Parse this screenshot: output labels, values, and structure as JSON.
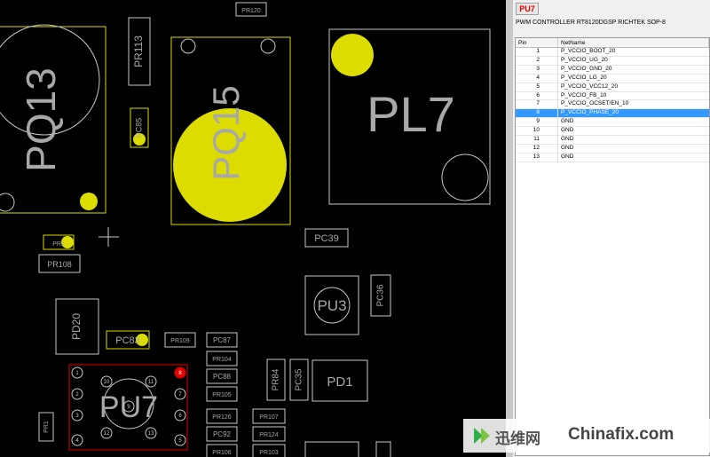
{
  "board": {
    "labels": {
      "pr120": "PR120",
      "pq13": "PQ13",
      "pr113": "PR113",
      "pc85": "PC85",
      "pq15": "PQ15",
      "pl7": "PL7",
      "pr1xx": "PR1",
      "pr108": "PR108",
      "pc39": "PC39",
      "pu3": "PU3",
      "pc36": "PC36",
      "pd20": "PD20",
      "pc83": "PC83",
      "pr109": "PR109",
      "pc87": "PC87",
      "pr104": "PR104",
      "pc88": "PC88",
      "pr105": "PR105",
      "pr84": "PR84",
      "pc35": "PC35",
      "pd1": "PD1",
      "pu7": "PU7",
      "pr126": "PR126",
      "pr107": "PR107",
      "pc92": "PC92",
      "pr124": "PR124",
      "pr106": "PR106",
      "pr103": "PR103",
      "pr1b": "PR1"
    },
    "pu7_pins": [
      "1",
      "2",
      "3",
      "4",
      "5",
      "6",
      "7",
      "8",
      "9",
      "10",
      "11",
      "12",
      "13"
    ],
    "colors": {
      "highlight": "#dcdc00",
      "outline": "#c8c8c8",
      "selected": "#e00000"
    }
  },
  "panel": {
    "component_button": "PU7",
    "description": "PWM CONTROLLER RT8120DGSP RICHTEK SOP-8",
    "columns": [
      "Pin",
      "NetName"
    ],
    "rows": [
      {
        "pin": "1",
        "net": "P_VCCIO_BOOT_20"
      },
      {
        "pin": "2",
        "net": "P_VCCIO_UG_20"
      },
      {
        "pin": "3",
        "net": "P_VCCIO_GND_20"
      },
      {
        "pin": "4",
        "net": "P_VCCIO_LG_20"
      },
      {
        "pin": "5",
        "net": "P_VCCIO_VCC12_20"
      },
      {
        "pin": "6",
        "net": "P_VCCIO_FB_10"
      },
      {
        "pin": "7",
        "net": "P_VCCIO_OCSET/EN_10"
      },
      {
        "pin": "8",
        "net": "P_VCCIO_PHASE_20"
      },
      {
        "pin": "9",
        "net": "GND"
      },
      {
        "pin": "10",
        "net": "GND"
      },
      {
        "pin": "11",
        "net": "GND"
      },
      {
        "pin": "12",
        "net": "GND"
      },
      {
        "pin": "13",
        "net": "GND"
      }
    ],
    "selected_pin": "8"
  },
  "watermark": {
    "cn": "迅维网",
    "en": "Chinafix.com"
  }
}
